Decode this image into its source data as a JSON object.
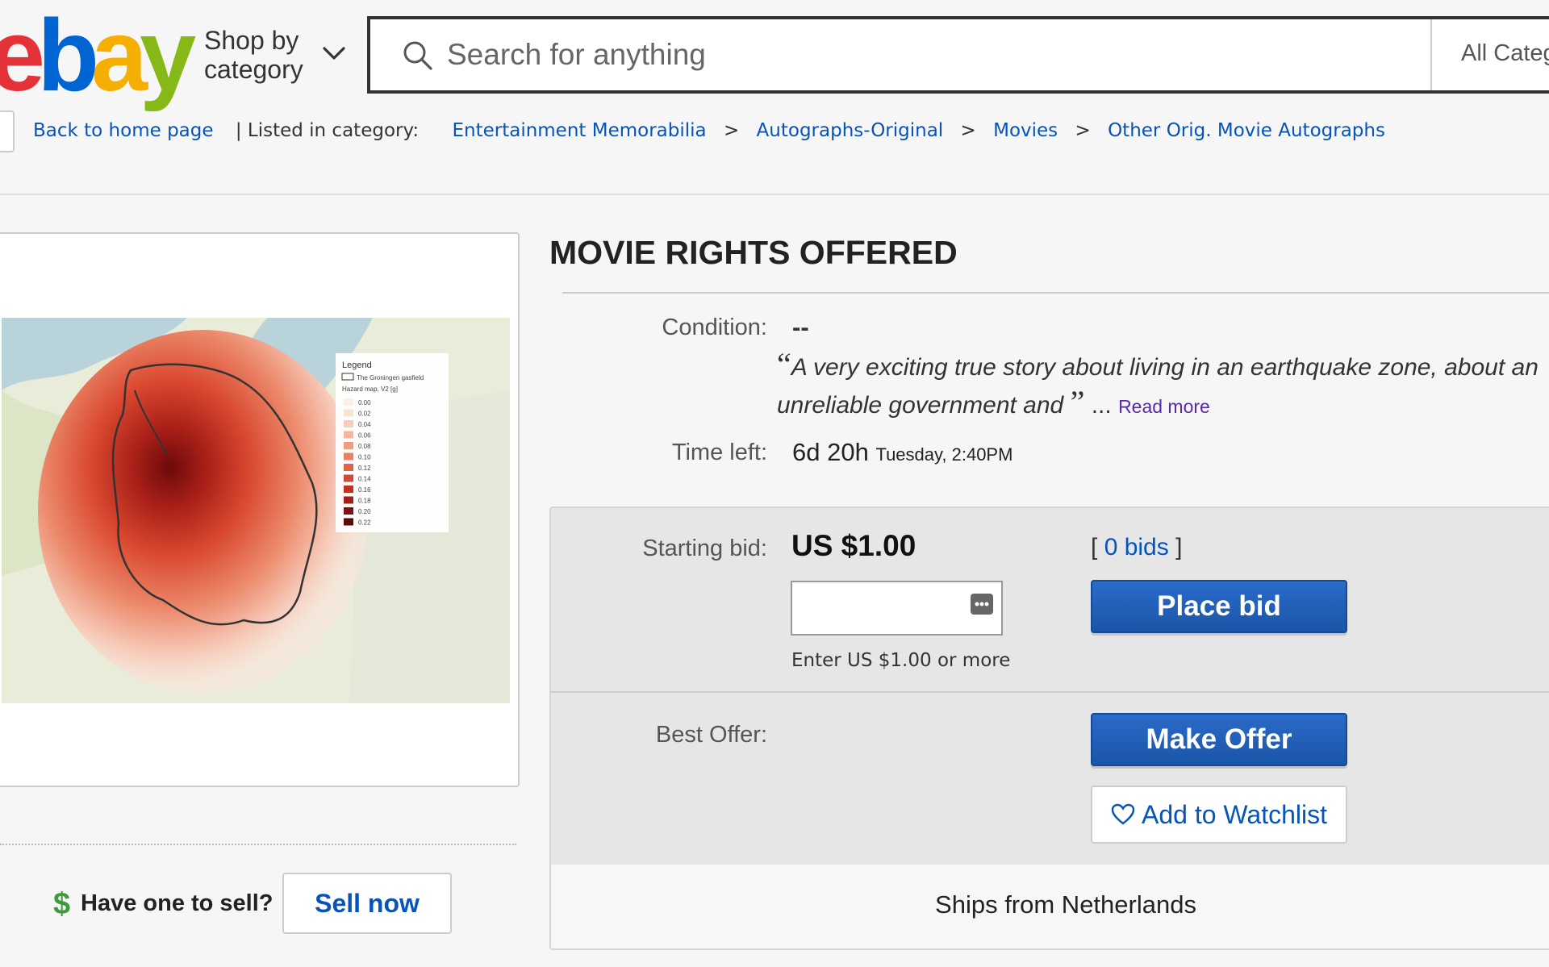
{
  "header": {
    "logo": {
      "e": "e",
      "b": "b",
      "a": "a",
      "y": "y"
    },
    "shop_by_line1": "Shop by",
    "shop_by_line2": "category",
    "search_placeholder": "Search for anything",
    "category_select": "All Categories",
    "colors": {
      "logo_red": "#e53238",
      "logo_blue": "#0064d2",
      "logo_yellow": "#f5af02",
      "logo_green": "#86b817",
      "link": "#0654ba"
    }
  },
  "breadcrumb": {
    "back_label": "Back to home page",
    "listed_label": "| Listed in category:",
    "items": [
      "Entertainment Memorabilia",
      "Autographs-Original",
      "Movies",
      "Other Orig. Movie Autographs"
    ],
    "separator": ">"
  },
  "image": {
    "legend_title": "Legend",
    "legend_entry_1": "The Groningen gasfield",
    "legend_entry_2": "Hazard map, V2 [g]",
    "legend_values": [
      "0.00",
      "0.02",
      "0.04",
      "0.06",
      "0.08",
      "0.10",
      "0.12",
      "0.14",
      "0.16",
      "0.18",
      "0.20",
      "0.22"
    ]
  },
  "sell": {
    "dollar": "$",
    "question": "Have one to sell?",
    "button": "Sell now"
  },
  "item": {
    "title": "MOVIE RIGHTS OFFERED",
    "condition_label": "Condition:",
    "condition_value": "--",
    "quote_open": "“",
    "quote_text": "A very exciting true story about living in an earthquake zone, about an unreliable government and",
    "quote_close": "”",
    "ellipsis": "...",
    "read_more": "Read more",
    "time_label": "Time left:",
    "time_value": "6d 20h",
    "time_end": "Tuesday, 2:40PM"
  },
  "bidding": {
    "starting_label": "Starting bid:",
    "starting_value": "US $1.00",
    "bids_open": "[",
    "bids_count": "0 bids",
    "bids_close": "]",
    "input_value": "",
    "hint": "Enter US $1.00 or more",
    "place_bid": "Place bid",
    "best_offer_label": "Best Offer:",
    "make_offer": "Make Offer",
    "watchlist": "Add to Watchlist",
    "ships_from": "Ships from Netherlands"
  }
}
